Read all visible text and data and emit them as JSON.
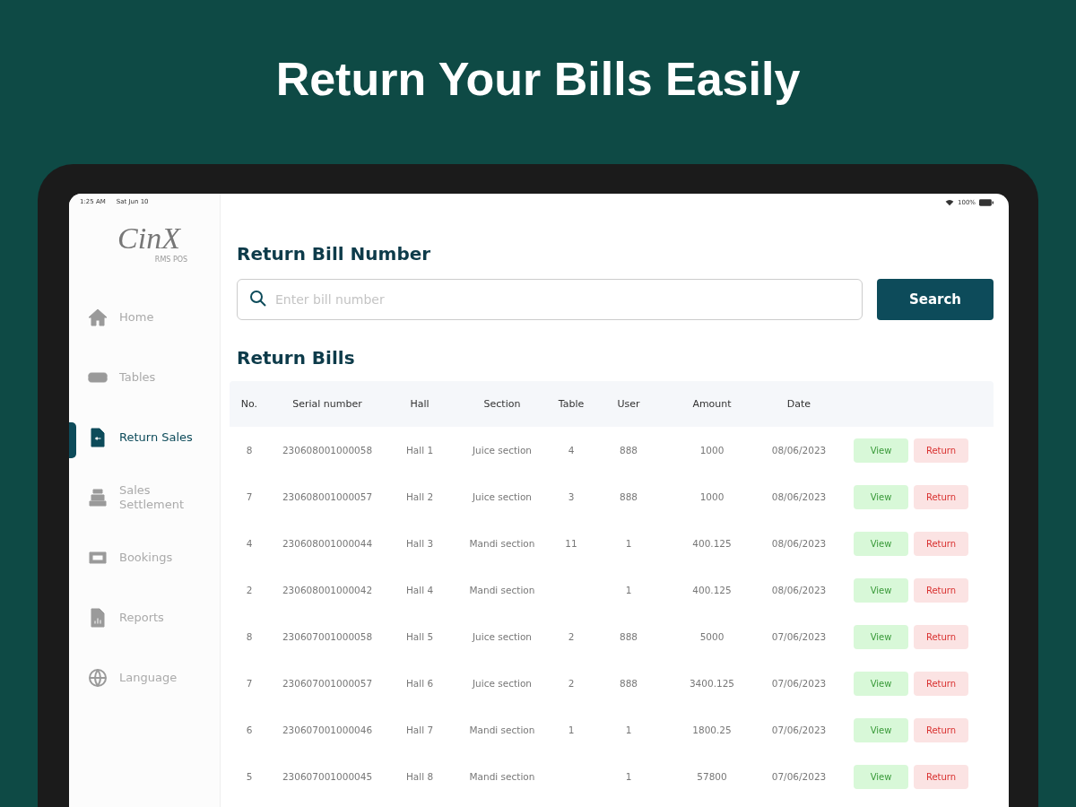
{
  "headline": "Return Your Bills Easily",
  "status_bar": {
    "time": "1:25 AM",
    "date": "Sat Jun 10",
    "battery": "100%"
  },
  "logo": {
    "mark": "CinX",
    "subtitle": "RMS POS"
  },
  "sidebar": {
    "items": [
      {
        "label": "Home",
        "selected": false
      },
      {
        "label": "Tables",
        "selected": false
      },
      {
        "label": "Return Sales",
        "selected": true
      },
      {
        "label": "Sales Settlement",
        "selected": false
      },
      {
        "label": "Bookings",
        "selected": false
      },
      {
        "label": "Reports",
        "selected": false
      },
      {
        "label": "Language",
        "selected": false
      }
    ]
  },
  "search_section": {
    "title": "Return Bill Number",
    "placeholder": "Enter bill number",
    "button": "Search"
  },
  "table": {
    "title": "Return Bills",
    "columns": [
      "No.",
      "Serial number",
      "Hall",
      "Section",
      "Table",
      "User",
      "Amount",
      "Date"
    ],
    "rows": [
      {
        "cells": [
          "8",
          "230608001000058",
          "Hall 1",
          "Juice section",
          "4",
          "888",
          "1000",
          "08/06/2023"
        ],
        "view": "View",
        "return": "Return"
      },
      {
        "cells": [
          "7",
          "230608001000057",
          "Hall 2",
          "Juice section",
          "3",
          "888",
          "1000",
          "08/06/2023"
        ],
        "view": "View",
        "return": "Return"
      },
      {
        "cells": [
          "4",
          "230608001000044",
          "Hall 3",
          "Mandi section",
          "11",
          "1",
          "400.125",
          "08/06/2023"
        ],
        "view": "View",
        "return": "Return"
      },
      {
        "cells": [
          "2",
          "230608001000042",
          "Hall 4",
          "Mandi section",
          "",
          "1",
          "400.125",
          "08/06/2023"
        ],
        "view": "View",
        "return": "Return"
      },
      {
        "cells": [
          "8",
          "230607001000058",
          "Hall 5",
          "Juice section",
          "2",
          "888",
          "5000",
          "07/06/2023"
        ],
        "view": "View",
        "return": "Return"
      },
      {
        "cells": [
          "7",
          "230607001000057",
          "Hall 6",
          "Juice section",
          "2",
          "888",
          "3400.125",
          "07/06/2023"
        ],
        "view": "View",
        "return": "Return"
      },
      {
        "cells": [
          "6",
          "230607001000046",
          "Hall 7",
          "Mandi section",
          "1",
          "1",
          "1800.25",
          "07/06/2023"
        ],
        "view": "View",
        "return": "Return"
      },
      {
        "cells": [
          "5",
          "230607001000045",
          "Hall 8",
          "Mandi section",
          "",
          "1",
          "57800",
          "07/06/2023"
        ],
        "view": "View",
        "return": "Return"
      }
    ]
  }
}
